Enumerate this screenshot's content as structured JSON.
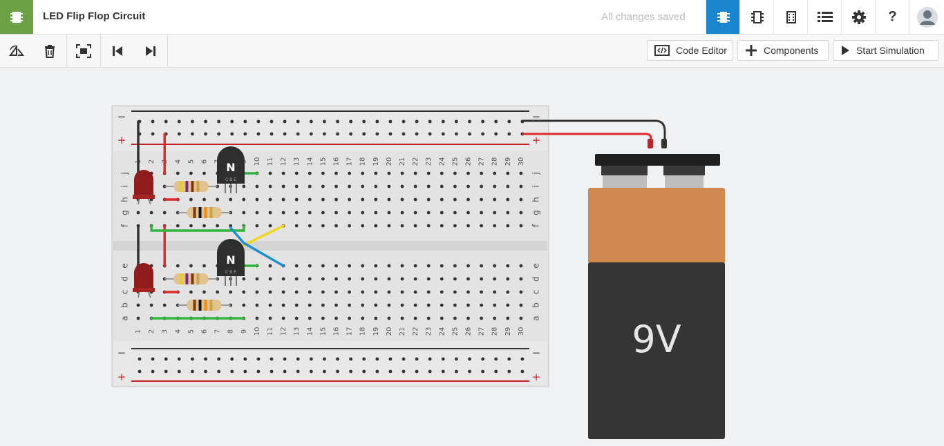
{
  "app": {
    "title": "LED Flip Flop Circuit",
    "save_status": "All changes saved"
  },
  "header_buttons": [
    {
      "name": "circuit-view-icon",
      "active": true
    },
    {
      "name": "schematic-view-icon",
      "active": false
    },
    {
      "name": "component-list-icon",
      "active": false
    },
    {
      "name": "list-view-icon",
      "active": false
    },
    {
      "name": "gear-icon",
      "active": false
    },
    {
      "name": "help-icon",
      "active": false
    },
    {
      "name": "avatar-icon",
      "active": false
    }
  ],
  "toolbar": {
    "tools": [
      "rotate-icon",
      "trash-icon",
      "fit-view-icon",
      "undo-icon",
      "redo-icon"
    ],
    "code_editor_label": "Code Editor",
    "components_label": "Components",
    "start_simulation_label": "Start Simulation"
  },
  "breadboard": {
    "columns": 30,
    "top_rows": [
      "j",
      "i",
      "h",
      "g",
      "f"
    ],
    "bottom_rows": [
      "e",
      "d",
      "c",
      "b",
      "a"
    ],
    "rail_minus": "−",
    "rail_plus": "+"
  },
  "components": {
    "transistor_label": "N",
    "transistor_pins": "C B E",
    "battery_label": "9V"
  },
  "colors": {
    "accent": "#1a86d0",
    "brand": "#6ca044",
    "wire_red": "#e02b2b",
    "wire_green": "#31b43c",
    "wire_yellow": "#f2d61b",
    "wire_blue": "#1a8fd6",
    "wire_black": "#333333",
    "battery_top": "#d08a50",
    "battery_body": "#353535"
  }
}
